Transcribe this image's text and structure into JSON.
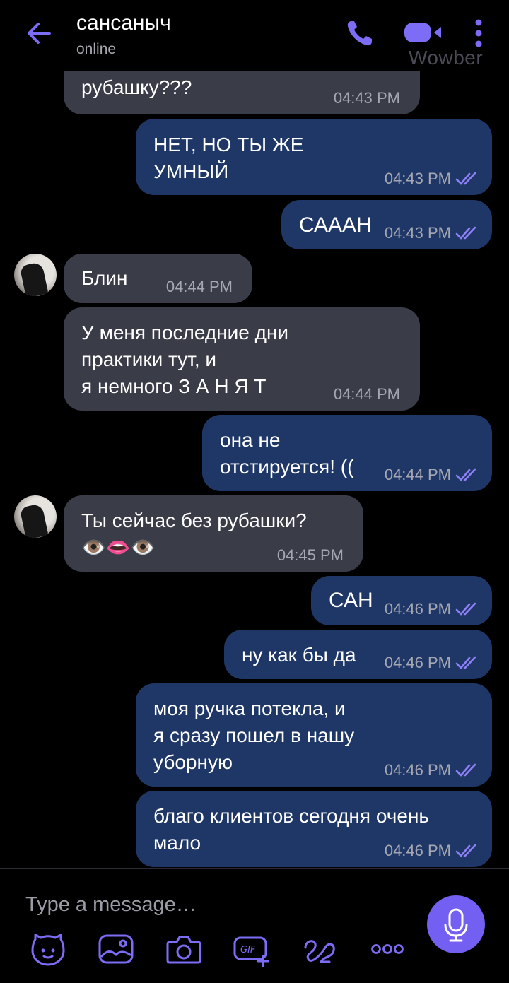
{
  "header": {
    "title": "сансаныч",
    "status": "online",
    "watermark": "Wowber"
  },
  "messages": [
    {
      "dir": "in",
      "text": "я смогу тебе постирать\nрубашку???",
      "time": "04:43 PM",
      "avatar": false
    },
    {
      "dir": "out",
      "text": "НЕТ, НО ТЫ ЖЕ\nУМНЫЙ",
      "time": "04:43 PM",
      "read": true
    },
    {
      "dir": "out",
      "text": "СААAН",
      "time": "04:43 PM",
      "read": true
    },
    {
      "dir": "in",
      "text": "Блин",
      "time": "04:44 PM",
      "avatar": true
    },
    {
      "dir": "in",
      "text": "У меня последние дни\nпрактики тут, и\nя немного З А Н Я Т",
      "time": "04:44 PM",
      "avatar": false
    },
    {
      "dir": "out",
      "text": "она не\nотстируется! ((",
      "time": "04:44 PM",
      "read": true
    },
    {
      "dir": "in",
      "text": "Ты сейчас без рубашки?\n👁️👄👁️",
      "time": "04:45 PM",
      "avatar": true
    },
    {
      "dir": "out",
      "text": "САН",
      "time": "04:46 PM",
      "read": true
    },
    {
      "dir": "out",
      "text": "ну как бы да",
      "time": "04:46 PM",
      "read": true
    },
    {
      "dir": "out",
      "text": "моя ручка потекла, и\nя сразу пошел в нашу\nуборную",
      "time": "04:46 PM",
      "read": true
    },
    {
      "dir": "out",
      "text": "благо клиентов сегодня очень\nмало",
      "time": "04:46 PM",
      "read": true
    }
  ],
  "composer": {
    "placeholder": "Type a message…",
    "toolbar_icons": [
      "sticker-icon",
      "gallery-icon",
      "camera-icon",
      "gif-icon",
      "doodle-icon",
      "more-options-icon"
    ],
    "mic_icon": "microphone-icon"
  },
  "colors": {
    "background": "#000000",
    "incoming_bubble": "#3a3c48",
    "outgoing_bubble": "#1e3766",
    "accent": "#7360f2",
    "timestamp": "#a5a7b3"
  }
}
